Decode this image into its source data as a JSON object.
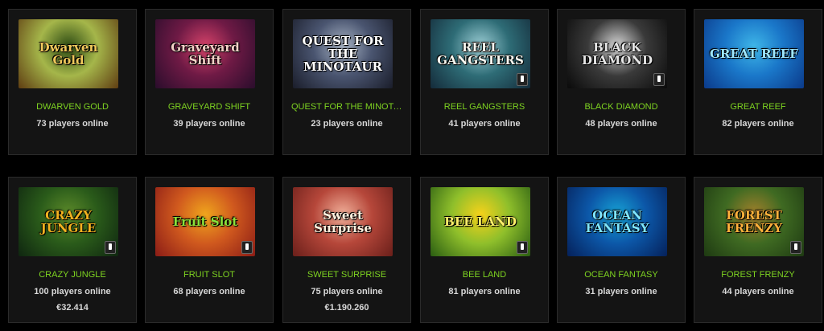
{
  "games": [
    {
      "title": "DWARVEN GOLD",
      "players": "73 players online",
      "logo": "Dwarven Gold",
      "colors": [
        "#5f3d12",
        "#a5b64a",
        "#2c4a13"
      ],
      "logo_color": "#f2c95c",
      "mobile": false,
      "jackpot": null
    },
    {
      "title": "GRAVEYARD SHIFT",
      "players": "39 players online",
      "logo": "Graveyard Shift",
      "colors": [
        "#2a0d2c",
        "#6f1a45",
        "#d6436a"
      ],
      "logo_color": "#f4d1c7",
      "mobile": false,
      "jackpot": null
    },
    {
      "title": "QUEST FOR THE MINOTA...",
      "players": "23 players online",
      "logo": "QUEST FOR THE MINOTAUR",
      "colors": [
        "#1a1d2a",
        "#4a5570",
        "#a9b5c6"
      ],
      "logo_color": "#ffffff",
      "mobile": false,
      "jackpot": null
    },
    {
      "title": "REEL GANGSTERS",
      "players": "41 players online",
      "logo": "REEL GANGSTERS",
      "colors": [
        "#142b3a",
        "#2e6c76",
        "#9ed0d7"
      ],
      "logo_color": "#f8f8f0",
      "mobile": true,
      "jackpot": null
    },
    {
      "title": "BLACK DIAMOND",
      "players": "48 players online",
      "logo": "BLACK DIAMOND",
      "colors": [
        "#0a0a0a",
        "#3a3a3a",
        "#d9d9d9"
      ],
      "logo_color": "#e6e6e6",
      "mobile": true,
      "jackpot": null
    },
    {
      "title": "GREAT REEF",
      "players": "82 players online",
      "logo": "GREAT REEF",
      "colors": [
        "#0b3a8a",
        "#1a77c9",
        "#3fb7e8"
      ],
      "logo_color": "#9ee7ff",
      "mobile": false,
      "jackpot": null
    },
    {
      "title": "CRAZY JUNGLE",
      "players": "100 players online",
      "logo": "CRAZY JUNGLE",
      "colors": [
        "#0f2610",
        "#2a5b1a",
        "#5d8b2a"
      ],
      "logo_color": "#f3b21f",
      "mobile": true,
      "jackpot": "€32.414"
    },
    {
      "title": "FRUIT SLOT",
      "players": "68 players online",
      "logo": "Fruit Slot",
      "colors": [
        "#8b1c16",
        "#d0591e",
        "#f0a61d"
      ],
      "logo_color": "#8be23a",
      "mobile": true,
      "jackpot": null
    },
    {
      "title": "SWEET SURPRISE",
      "players": "75 players online",
      "logo": "Sweet Surprise",
      "colors": [
        "#6a1f1a",
        "#b6473a",
        "#f1b09a"
      ],
      "logo_color": "#fff0de",
      "mobile": false,
      "jackpot": "€1.190.260"
    },
    {
      "title": "BEE LAND",
      "players": "81 players online",
      "logo": "BEE LAND",
      "colors": [
        "#2a5d12",
        "#8fbf2b",
        "#f7d21a"
      ],
      "logo_color": "#fff06a",
      "mobile": true,
      "jackpot": null
    },
    {
      "title": "OCEAN FANTASY",
      "players": "31 players online",
      "logo": "OCEAN FANTASY",
      "colors": [
        "#05215a",
        "#0c57a8",
        "#17a3d5"
      ],
      "logo_color": "#7fe6ff",
      "mobile": false,
      "jackpot": null
    },
    {
      "title": "FOREST FRENZY",
      "players": "44 players online",
      "logo": "FOREST FRENZY",
      "colors": [
        "#1e3a12",
        "#3f6a22",
        "#a5812c"
      ],
      "logo_color": "#ffb13b",
      "mobile": true,
      "jackpot": null
    }
  ]
}
